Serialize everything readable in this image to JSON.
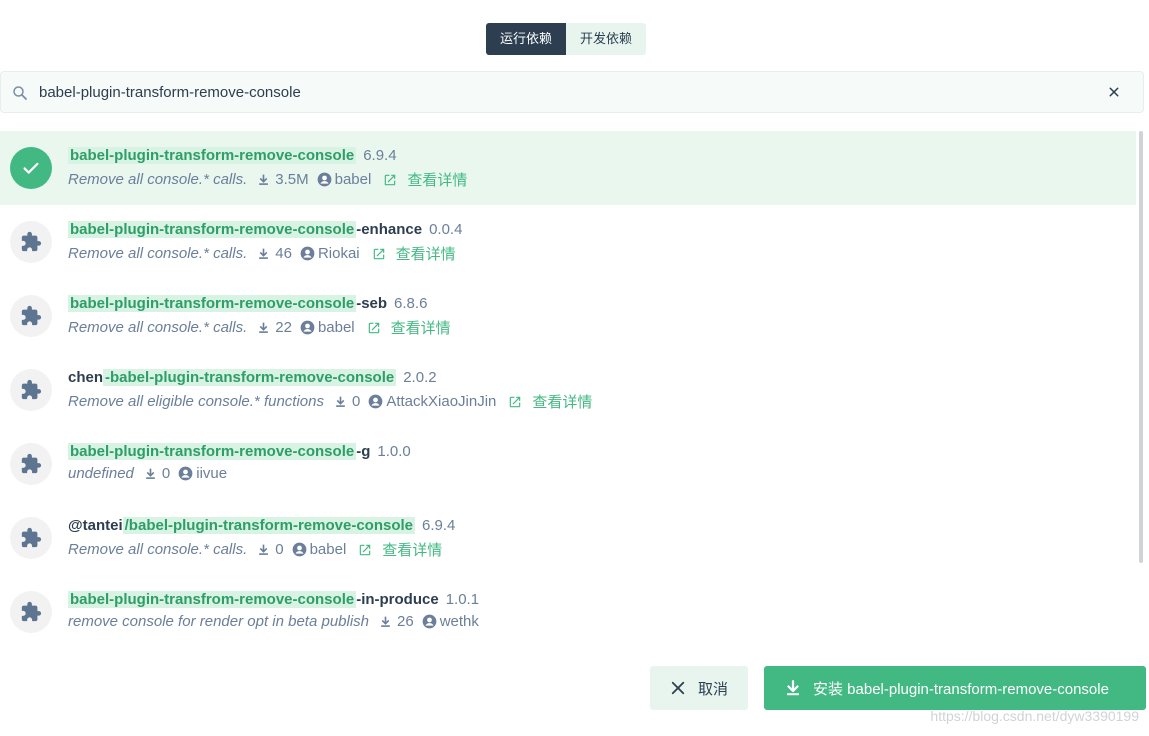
{
  "tabs": [
    {
      "label": "运行依赖",
      "active": true
    },
    {
      "label": "开发依赖",
      "active": false
    }
  ],
  "search": {
    "value": "babel-plugin-transform-remove-console",
    "placeholder": ""
  },
  "query": "babel-plugin-transform-remove-console",
  "packages": [
    {
      "prefix": "",
      "highlight": "babel-plugin-transform-remove-console",
      "suffix": "",
      "version": "6.9.4",
      "description": "Remove all console.* calls.",
      "downloads": "3.5M",
      "author": "babel",
      "detail": "查看详情",
      "selected": true
    },
    {
      "prefix": "",
      "highlight": "babel-plugin-transform-remove-console",
      "suffix": "-enhance",
      "version": "0.0.4",
      "description": "Remove all console.* calls.",
      "downloads": "46",
      "author": "Riokai",
      "detail": "查看详情",
      "selected": false
    },
    {
      "prefix": "",
      "highlight": "babel-plugin-transform-remove-console",
      "suffix": "-seb",
      "version": "6.8.6",
      "description": "Remove all console.* calls.",
      "downloads": "22",
      "author": "babel",
      "detail": "查看详情",
      "selected": false
    },
    {
      "prefix": "chen",
      "highlight": "-babel-plugin-transform-remove-console",
      "suffix": "",
      "version": "2.0.2",
      "description": "Remove all eligible console.* functions",
      "downloads": "0",
      "author": "AttackXiaoJinJin",
      "detail": "查看详情",
      "selected": false
    },
    {
      "prefix": "",
      "highlight": "babel-plugin-transform-remove-console",
      "suffix": "-g",
      "version": "1.0.0",
      "description": "undefined",
      "downloads": "0",
      "author": "iivue",
      "detail": "",
      "selected": false
    },
    {
      "prefix": "@tantei",
      "highlight": "/babel-plugin-transform-remove-console",
      "suffix": "",
      "version": "6.9.4",
      "description": "Remove all console.* calls.",
      "downloads": "0",
      "author": "babel",
      "detail": "查看详情",
      "selected": false
    },
    {
      "prefix": "",
      "highlight": "babel-plugin-transfrom-remove-console",
      "suffix": "-in-produce",
      "version": "1.0.1",
      "description": "remove console for render opt in beta publish",
      "downloads": "26",
      "author": "wethk",
      "detail": "",
      "selected": false
    }
  ],
  "buttons": {
    "cancel": "取消",
    "install": "安装 babel-plugin-transform-remove-console"
  },
  "watermark": "https://blog.csdn.net/dyw3390199",
  "colors": {
    "accent": "#42b983",
    "accent_light": "#e8f5ee",
    "dark": "#2c3e50",
    "muted": "#6b7f9a"
  },
  "icons": {
    "search": "search-icon",
    "clear": "close-icon",
    "selected": "check-icon",
    "package": "puzzle-icon",
    "downloads": "download-icon",
    "author": "user-circle-icon",
    "detail": "external-link-icon",
    "cancel": "close-icon",
    "install": "download-icon"
  }
}
